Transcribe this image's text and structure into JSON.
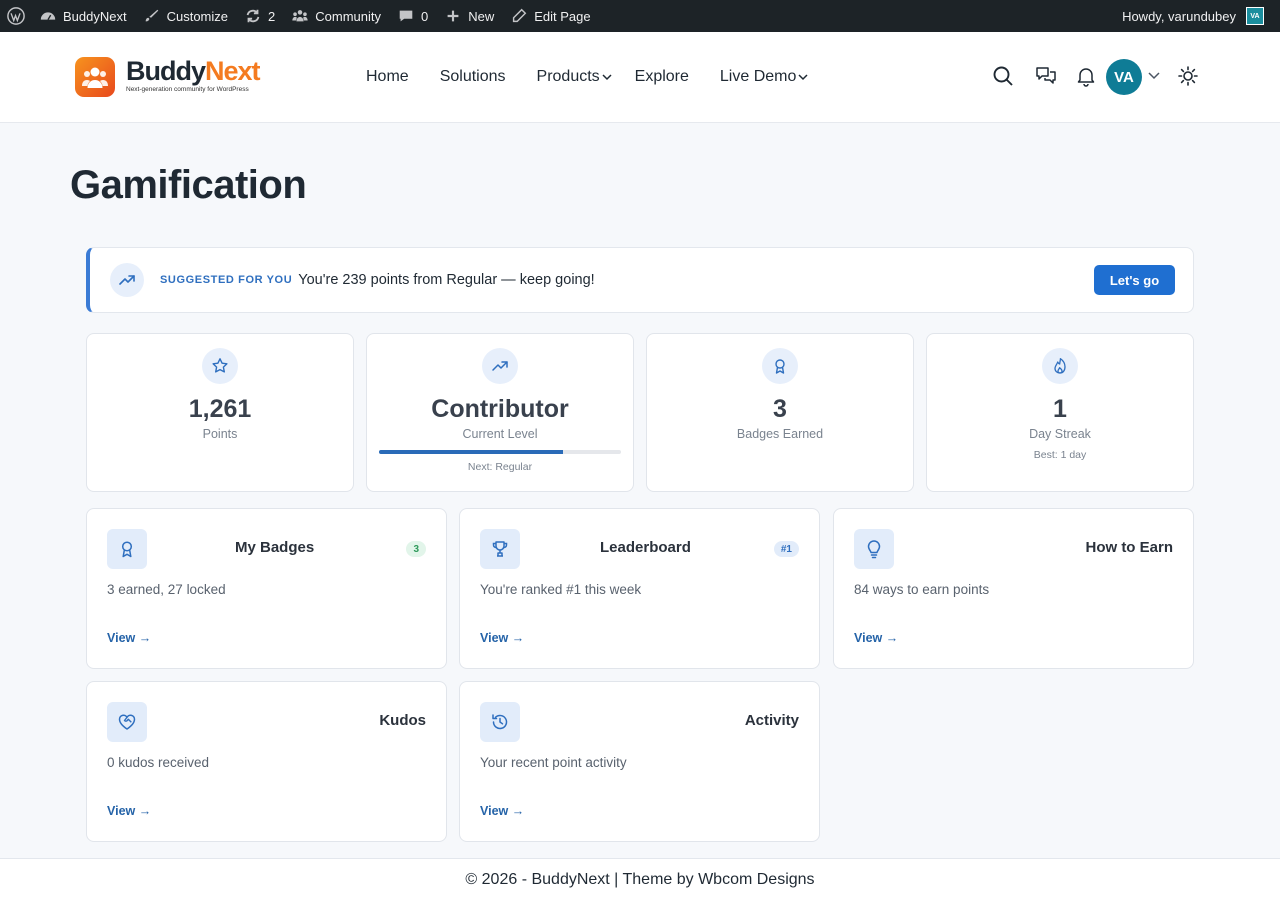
{
  "admin_bar": {
    "site_name": "BuddyNext",
    "customize": "Customize",
    "updates_count": "2",
    "community": "Community",
    "comments_count": "0",
    "new": "New",
    "edit_page": "Edit Page",
    "howdy": "Howdy, varundubey",
    "avatar_initials": "VA"
  },
  "header": {
    "logo_name_part1": "Buddy",
    "logo_name_part2": "Next",
    "logo_tagline": "Next-generation community for WordPress",
    "nav": [
      "Home",
      "Solutions",
      "Products",
      "Explore",
      "Live Demo"
    ],
    "avatar_initials": "VA"
  },
  "page": {
    "title": "Gamification"
  },
  "suggestion": {
    "label": "SUGGESTED FOR YOU",
    "text": "You're 239 points from Regular — keep going!",
    "button": "Let's go"
  },
  "stats": [
    {
      "value": "1,261",
      "label": "Points"
    },
    {
      "value": "Contributor",
      "label": "Current Level",
      "progress": 0.76,
      "sub": "Next: Regular"
    },
    {
      "value": "3",
      "label": "Badges Earned"
    },
    {
      "value": "1",
      "label": "Day Streak",
      "sub": "Best: 1 day"
    }
  ],
  "cards": [
    {
      "title": "My Badges",
      "badge": "3",
      "desc": "3 earned, 27 locked",
      "link": "View →"
    },
    {
      "title": "Leaderboard",
      "badge": "#1",
      "desc": "You're ranked #1 this week",
      "link": "View →"
    },
    {
      "title": "How to Earn",
      "desc": "84 ways to earn points",
      "link": "View →"
    },
    {
      "title": "Kudos",
      "desc": "0 kudos received",
      "link": "View →"
    },
    {
      "title": "Activity",
      "desc": "Your recent point activity",
      "link": "View →"
    }
  ],
  "footer": {
    "text": "© 2026 - BuddyNext | Theme by Wbcom Designs"
  },
  "colors": {
    "accent": "#1f6fd1",
    "brand_orange": "#f47b20",
    "avatar": "#0f7c96",
    "admin_bar": "#1d2327"
  }
}
